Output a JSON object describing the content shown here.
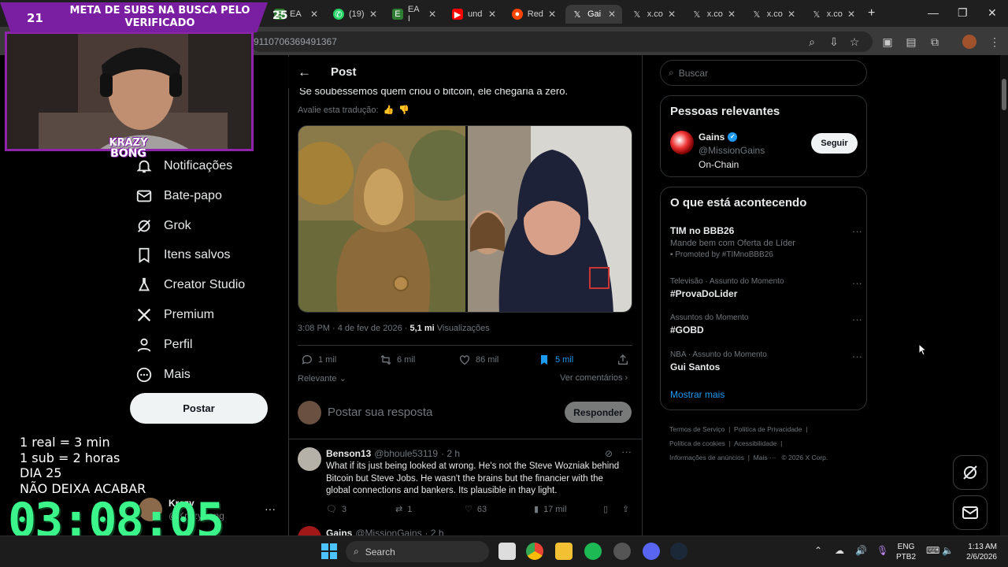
{
  "browser": {
    "tabs": [
      {
        "label": "EA",
        "icon": "ea-icon"
      },
      {
        "label": "(19)",
        "icon": "whatsapp-icon"
      },
      {
        "label": "EA I",
        "icon": "ea-icon"
      },
      {
        "label": "und",
        "icon": "youtube-icon"
      },
      {
        "label": "Red",
        "icon": "reddit-icon"
      },
      {
        "label": "Gai",
        "icon": "x-icon"
      },
      {
        "label": "x.co",
        "icon": "x-icon"
      },
      {
        "label": "x.co",
        "icon": "x-icon"
      },
      {
        "label": "x.co",
        "icon": "x-icon"
      },
      {
        "label": "x.co",
        "icon": "x-icon"
      }
    ],
    "url": "9110706369491367"
  },
  "stream": {
    "subgoal_count": "21",
    "subgoal_title": "META DE SUBS NA BUSCA PELO VERIFICADO",
    "badge_number": "25",
    "logo_line1": "KRAZY",
    "logo_line2": "BONG",
    "rules": [
      "1 real = 3 min",
      "1 sub = 2 horas",
      "DIA 25",
      "NÃO DEIXA ACABAR"
    ],
    "timer": "03:08:05"
  },
  "nav": {
    "items": [
      {
        "label": "Notificações",
        "icon": "bell-icon"
      },
      {
        "label": "Bate-papo",
        "icon": "mail-icon"
      },
      {
        "label": "Grok",
        "icon": "grok-icon"
      },
      {
        "label": "Itens salvos",
        "icon": "bookmark-icon"
      },
      {
        "label": "Creator Studio",
        "icon": "flask-icon"
      },
      {
        "label": "Premium",
        "icon": "x-icon"
      },
      {
        "label": "Perfil",
        "icon": "person-icon"
      },
      {
        "label": "Mais",
        "icon": "more-icon"
      }
    ],
    "post_button": "Postar",
    "account_name": "Krazy",
    "account_handle": "@KrazyBong"
  },
  "post": {
    "header_title": "Post",
    "text": "Se soubéssemos quem criou o bitcoin, ele chegaria a zero.",
    "rate_translation": "Avalie esta tradução:",
    "timestamp": "3:08 PM · 4 de fev de 2026 · ",
    "views_count": "5,1 mi",
    "views_label": "Visualizações",
    "replies": "1 mil",
    "reposts": "6 mil",
    "likes": "86 mil",
    "bookmarks": "5 mil",
    "sort_label": "Relevante",
    "see_comments": "Ver comentários",
    "reply_placeholder": "Postar sua resposta",
    "reply_button": "Responder"
  },
  "comments": [
    {
      "name": "Benson13",
      "handle": "@bhoule53119",
      "time": "· 2 h",
      "text": "What if its just being looked at wrong. He's not the Steve Wozniak behind Bitcoin but Steve Jobs. He wasn't the brains but the financier with the global connections and bankers. Its plausible in thay light.",
      "replies": "3",
      "reposts": "1",
      "likes": "63",
      "views": "17 mil"
    },
    {
      "name": "Gains",
      "handle": "@MissionGains",
      "time": "· 2 h"
    }
  ],
  "sidebar": {
    "search_placeholder": "Buscar",
    "relevant_title": "Pessoas relevantes",
    "person_name": "Gains",
    "person_handle": "@MissionGains",
    "person_bio": "On-Chain",
    "follow_button": "Seguir",
    "happening_title": "O que está acontecendo",
    "trends": [
      {
        "category": "",
        "name": "TIM no BBB26",
        "sub": "Mande bem com Oferta de Líder",
        "promo": "Promoted by #TIMnoBBB26"
      },
      {
        "category": "Televisão · Assunto do Momento",
        "name": "#ProvaDoLider"
      },
      {
        "category": "Assuntos do Momento",
        "name": "#GOBD"
      },
      {
        "category": "NBA · Assunto do Momento",
        "name": "Gui Santos"
      }
    ],
    "show_more": "Mostrar mais",
    "footer": [
      "Termos de Serviço",
      "Política de Privacidade",
      "Política de cookies",
      "Acessibilidade",
      "Informações de anúncios",
      "Mais ···",
      "© 2026 X Corp."
    ]
  },
  "taskbar": {
    "search_label": "Search",
    "lang1": "ENG",
    "lang2": "PTB2",
    "time": "1:13 AM",
    "date": "2/6/2026"
  }
}
